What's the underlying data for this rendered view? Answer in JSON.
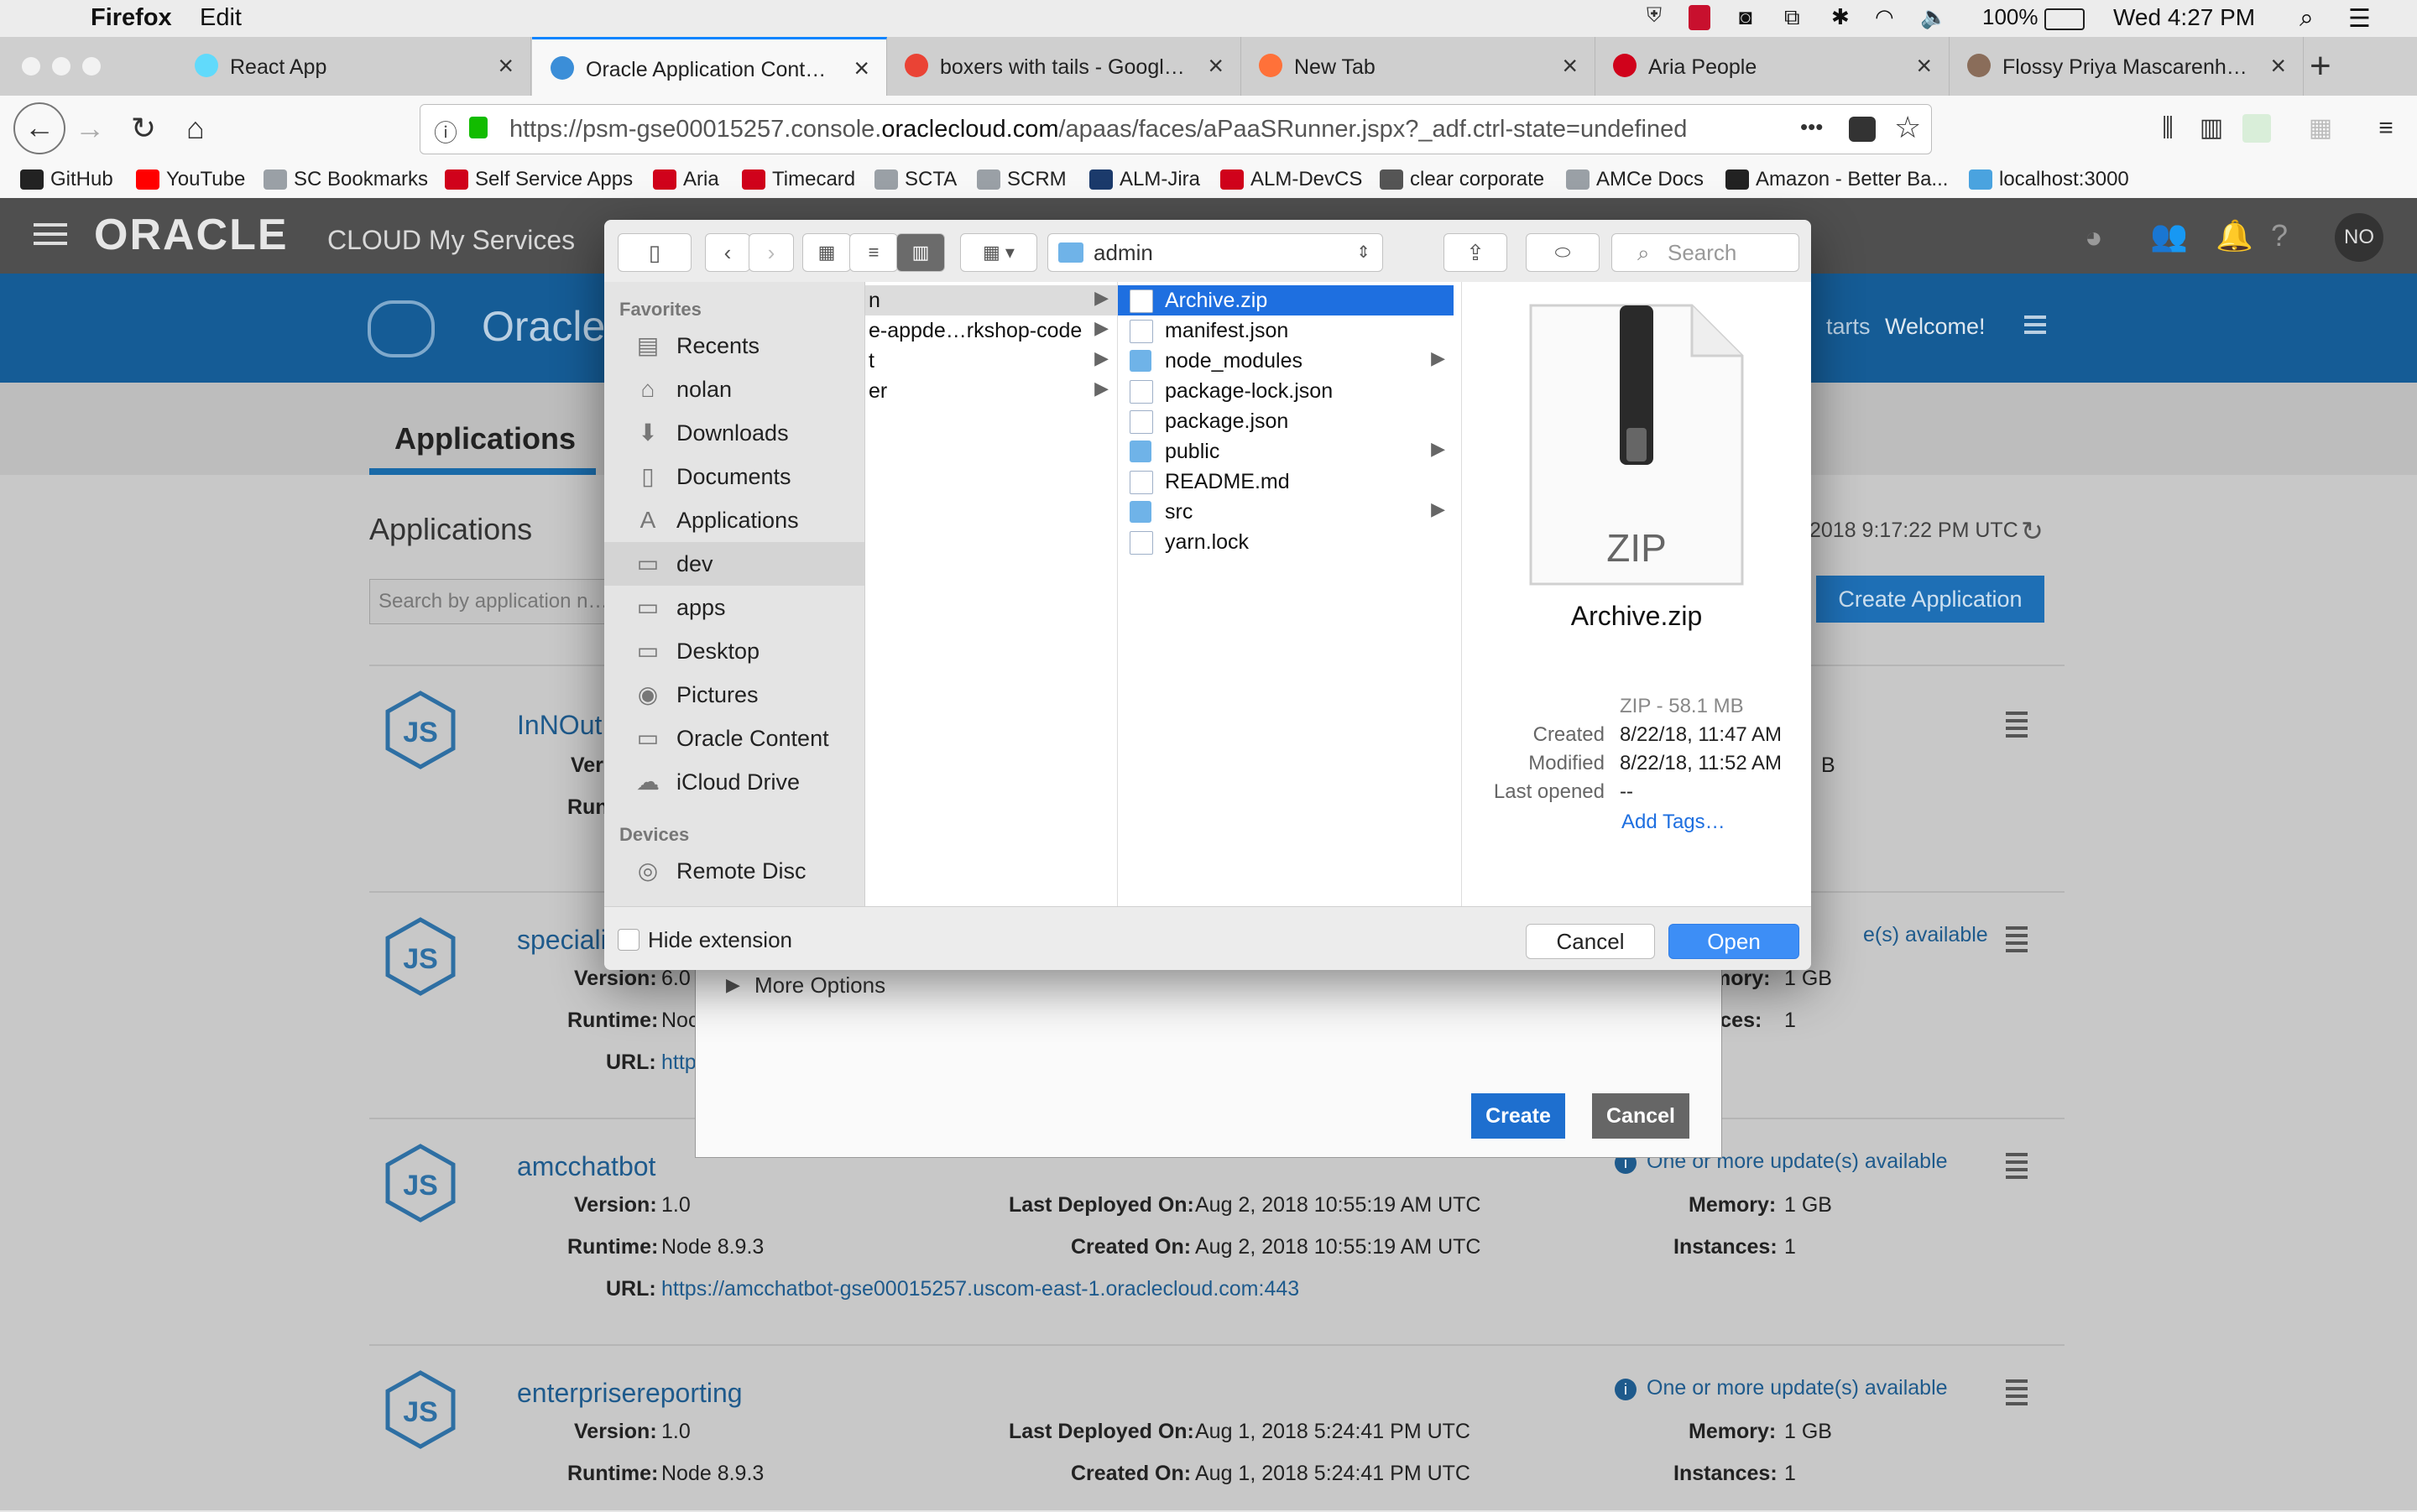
{
  "menubar": {
    "app": "Firefox",
    "edit": "Edit",
    "battery": "100%",
    "clock": "Wed 4:27 PM"
  },
  "tabs": [
    {
      "label": "React App",
      "color": "#61dafb"
    },
    {
      "label": "Oracle Application Container",
      "color": "#3b8ed8",
      "active": true
    },
    {
      "label": "boxers with tails - Google Se",
      "color": "#ea4335"
    },
    {
      "label": "New Tab",
      "color": "#ff7139"
    },
    {
      "label": "Aria People",
      "color": "#d0021b"
    },
    {
      "label": "Flossy Priya Mascarenhas - A",
      "color": "#8a6d5a"
    }
  ],
  "url": {
    "prefix": "https://psm-gse00015257.console.",
    "domain": "oraclecloud.com",
    "path": "/apaas/faces/aPaaSRunner.jspx?_adf.ctrl-state=undefined",
    "more": "•••"
  },
  "bookmarks": [
    {
      "label": "GitHub",
      "color": "#222222"
    },
    {
      "label": "YouTube",
      "color": "#ff0000"
    },
    {
      "label": "SC Bookmarks",
      "color": "#9aa0a6"
    },
    {
      "label": "Self Service Apps",
      "color": "#d0021b"
    },
    {
      "label": "Aria",
      "color": "#d0021b"
    },
    {
      "label": "Timecard",
      "color": "#d0021b"
    },
    {
      "label": "SCTA",
      "color": "#9aa0a6"
    },
    {
      "label": "SCRM",
      "color": "#9aa0a6"
    },
    {
      "label": "ALM-Jira",
      "color": "#1b3a6b"
    },
    {
      "label": "ALM-DevCS",
      "color": "#d0021b"
    },
    {
      "label": "clear corporate",
      "color": "#555555"
    },
    {
      "label": "AMCe Docs",
      "color": "#9aa0a6"
    },
    {
      "label": "Amazon - Better Ba...",
      "color": "#222222"
    },
    {
      "label": "localhost:3000",
      "color": "#4aa3df"
    }
  ],
  "oracle": {
    "brand": "ORACLE",
    "subtitle": "CLOUD My Services",
    "avatar": "NO",
    "banner_title_partial": "Oracle",
    "banner_right_partial": "tarts",
    "welcome": "Welcome!"
  },
  "apps_page": {
    "tab": "Applications",
    "heading": "Applications",
    "search_placeholder": "Search by application name",
    "refresh_partial": "2018 9:17:22 PM UTC",
    "create_button": "Create Application",
    "cards": [
      {
        "name": "InNOut",
        "version_label_partial": "Ver",
        "runtime_label_partial": "Run",
        "memory_partial": "B"
      },
      {
        "name": "speciali",
        "update_partial": "e(s) available",
        "version_label": "Version:",
        "version": "6.0",
        "runtime_label": "Runtime:",
        "runtime": "Noc",
        "url_label": "URL:",
        "url": "http",
        "memory_label_partial": "mory:",
        "memory": "1 GB",
        "instances_label_partial": "nces:",
        "instances": "1"
      },
      {
        "name": "amcchatbot",
        "update": "One or more update(s) available",
        "version_label": "Version:",
        "version": "1.0",
        "runtime_label": "Runtime:",
        "runtime": "Node 8.9.3",
        "url_label": "URL:",
        "url": "https://amcchatbot-gse00015257.uscom-east-1.oraclecloud.com:443",
        "deployed_label": "Last Deployed On:",
        "deployed": "Aug 2, 2018 10:55:19 AM UTC",
        "created_label": "Created On:",
        "created": "Aug 2, 2018 10:55:19 AM UTC",
        "memory_label": "Memory:",
        "memory": "1 GB",
        "instances_label": "Instances:",
        "instances": "1"
      },
      {
        "name": "enterprisereporting",
        "update": "One or more update(s) available",
        "version_label": "Version:",
        "version": "1.0",
        "runtime_label": "Runtime:",
        "runtime": "Node 8.9.3",
        "deployed_label": "Last Deployed On:",
        "deployed": "Aug 1, 2018 5:24:41 PM UTC",
        "created_label": "Created On:",
        "created": "Aug 1, 2018 5:24:41 PM UTC",
        "memory_label": "Memory:",
        "memory": "1 GB",
        "instances_label": "Instances:",
        "instances": "1"
      }
    ]
  },
  "create_dialog": {
    "more_options": "More Options",
    "create": "Create",
    "cancel": "Cancel"
  },
  "file_dialog": {
    "location": "admin",
    "search_placeholder": "Search",
    "favorites_header": "Favorites",
    "favorites": [
      {
        "label": "Recents",
        "icon": "clock-icon",
        "glyph": "▤"
      },
      {
        "label": "nolan",
        "icon": "home-icon",
        "glyph": "⌂"
      },
      {
        "label": "Downloads",
        "icon": "downloads-icon",
        "glyph": "⬇"
      },
      {
        "label": "Documents",
        "icon": "documents-icon",
        "glyph": "▯"
      },
      {
        "label": "Applications",
        "icon": "applications-icon",
        "glyph": "A"
      },
      {
        "label": "dev",
        "icon": "folder-icon",
        "glyph": "▭",
        "selected": true
      },
      {
        "label": "apps",
        "icon": "folder-icon",
        "glyph": "▭"
      },
      {
        "label": "Desktop",
        "icon": "desktop-icon",
        "glyph": "▭"
      },
      {
        "label": "Pictures",
        "icon": "camera-icon",
        "glyph": "◉"
      },
      {
        "label": "Oracle Content",
        "icon": "folder-icon",
        "glyph": "▭"
      },
      {
        "label": "iCloud Drive",
        "icon": "cloud-icon",
        "glyph": "☁"
      }
    ],
    "devices_header": "Devices",
    "devices": [
      {
        "label": "Remote Disc",
        "icon": "disc-icon",
        "glyph": "◎"
      }
    ],
    "column1": [
      {
        "label": "n",
        "selected_parent": true
      },
      {
        "label": "e-appde…rkshop-code"
      },
      {
        "label": "t"
      },
      {
        "label": "er"
      }
    ],
    "column2": [
      {
        "label": "Archive.zip",
        "kind": "doc",
        "selected": true
      },
      {
        "label": "manifest.json",
        "kind": "doc"
      },
      {
        "label": "node_modules",
        "kind": "folder",
        "arrow": true
      },
      {
        "label": "package-lock.json",
        "kind": "doc"
      },
      {
        "label": "package.json",
        "kind": "doc"
      },
      {
        "label": "public",
        "kind": "folder",
        "arrow": true
      },
      {
        "label": "README.md",
        "kind": "doc"
      },
      {
        "label": "src",
        "kind": "folder",
        "arrow": true
      },
      {
        "label": "yarn.lock",
        "kind": "doc"
      }
    ],
    "preview": {
      "badge": "ZIP",
      "filename": "Archive.zip",
      "kind_size": "ZIP - 58.1 MB",
      "created_label": "Created",
      "created": "8/22/18, 11:47 AM",
      "modified_label": "Modified",
      "modified": "8/22/18, 11:52 AM",
      "opened_label": "Last opened",
      "opened": "--",
      "add_tags": "Add Tags…"
    },
    "hide_extension": "Hide extension",
    "cancel": "Cancel",
    "open": "Open"
  }
}
